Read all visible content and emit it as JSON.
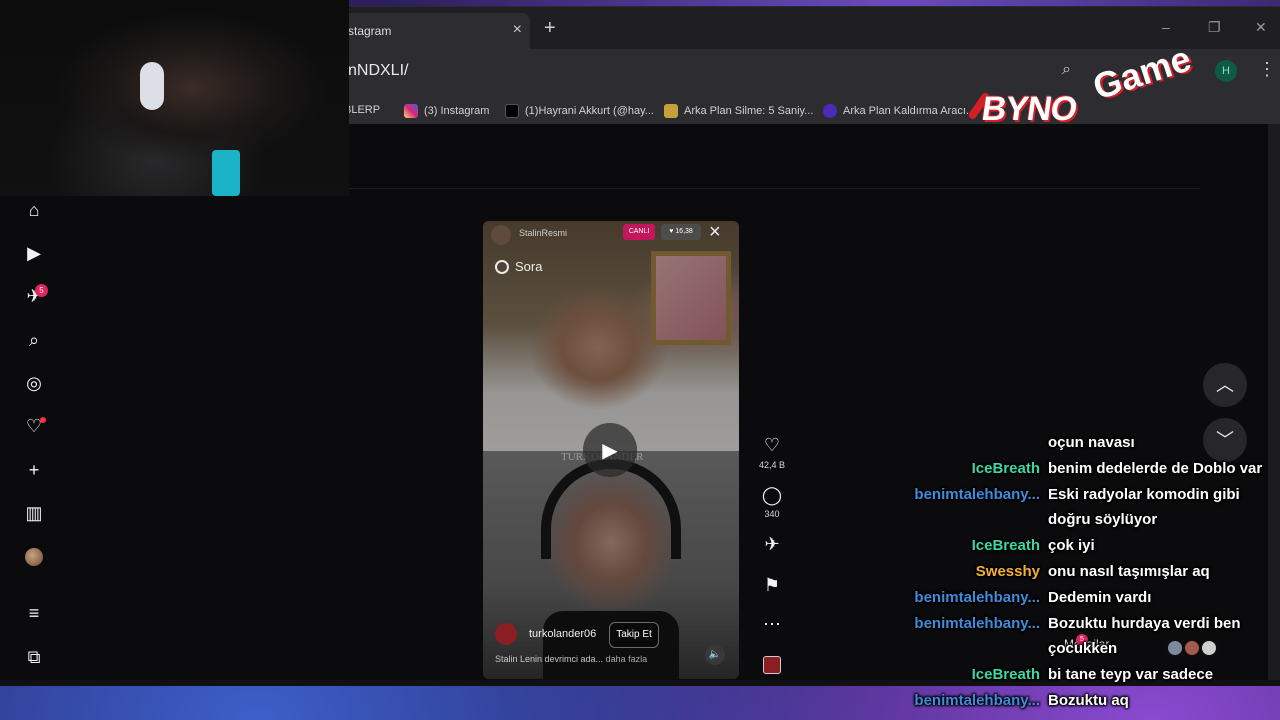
{
  "browser": {
    "tab_title": "stagram",
    "tab_close": "×",
    "new_tab": "+",
    "url": "nNDXLI/",
    "profile_initial": "H",
    "minimize": "–",
    "maximize": "❐",
    "close": "✕"
  },
  "bookmarks": [
    {
      "label": "BLERP",
      "color": "#d92b2b"
    },
    {
      "label": "(3) Instagram",
      "color": "#d6249f"
    },
    {
      "label": "(1)Hayrani Akkurt (@hay...",
      "color": "#111111"
    },
    {
      "label": "Arka Plan Silme: 5 Saniy...",
      "color": "#c9a13b"
    },
    {
      "label": "Arka Plan Kaldırma Aracı...",
      "color": "#4b2bb8"
    }
  ],
  "sidebar": {
    "notif_count": "5",
    "icons": [
      "home-icon",
      "reels-icon",
      "messages-icon",
      "search-icon",
      "explore-icon",
      "notifications-icon",
      "create-icon",
      "dashboard-icon",
      "profile-avatar",
      "more-menu-icon",
      "apps-icon"
    ]
  },
  "reel": {
    "top_user": "StalinResmi",
    "live_label": "CANLI",
    "viewers": "♥ 16,38",
    "sora_label": "Sora",
    "watermark": "TURKOLANDER",
    "bottom_user": "turkolander06",
    "follow_label": "Takip Et",
    "caption": "Stalin Lenin devrimci ada...",
    "more_label": "daha fazla"
  },
  "actions": {
    "likes": "42,4 B",
    "comments": "340"
  },
  "messages_chip": "Mesajlar",
  "messages_badge": "5",
  "logo": {
    "byno": "BYNO",
    "game": "Game"
  },
  "chat": [
    {
      "user": "",
      "color": "#ffffff",
      "msg": "oçun navası"
    },
    {
      "user": "IceBreath",
      "color": "#3dd6a4",
      "msg": "benim dedelerde de Doblo var"
    },
    {
      "user": "benimtalehbany...",
      "color": "#3f8bdc",
      "msg": "Eski radyolar komodin gibi doğru söylüyor"
    },
    {
      "user": "IceBreath",
      "color": "#3dd6a4",
      "msg": "çok iyi"
    },
    {
      "user": "Swesshy",
      "color": "#f2b233",
      "msg": "onu nasıl taşımışlar aq"
    },
    {
      "user": "benimtalehbany...",
      "color": "#3f8bdc",
      "msg": "Dedemin vardı"
    },
    {
      "user": "benimtalehbany...",
      "color": "#3f8bdc",
      "msg": "Bozuktu hurdaya verdi ben çocukken"
    },
    {
      "user": "IceBreath",
      "color": "#3dd6a4",
      "msg": "bi tane teyp var sadece"
    },
    {
      "user": "benimtalehbany...",
      "color": "#3f8bdc",
      "msg": "Bozuktu aq"
    }
  ]
}
